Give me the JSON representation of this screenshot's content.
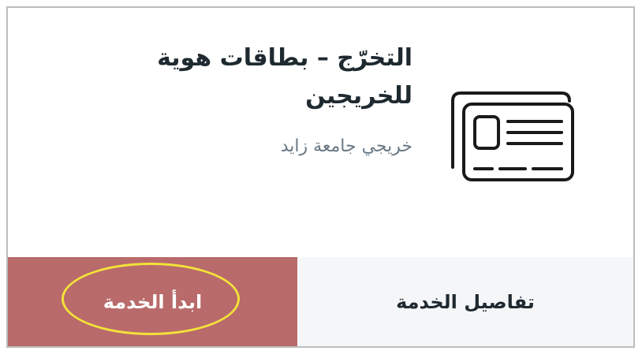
{
  "service": {
    "title": "التخرّج – بطاقات هوية للخريجين",
    "subtitle": "خريجي جامعة زايد",
    "icon": "id-cards-icon"
  },
  "actions": {
    "start_label": "ابدأ الخدمة",
    "details_label": "تفاصيل الخدمة"
  },
  "colors": {
    "start_bg": "#b96a6a",
    "details_bg": "#f5f6f8",
    "highlight": "#f2e23a"
  }
}
